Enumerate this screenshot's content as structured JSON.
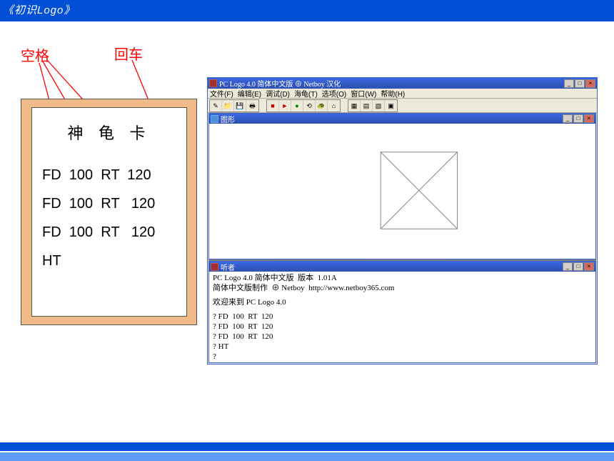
{
  "header": {
    "title": "《初识Logo》"
  },
  "labels": {
    "space": "空格",
    "enter": "回车"
  },
  "card": {
    "title": "神 龟 卡",
    "lines": [
      "FD  100  RT  120",
      "FD  100  RT   120",
      "FD  100  RT   120",
      "HT"
    ]
  },
  "app": {
    "title": "PC Logo 4.0 简体中文版 ⊕ Netboy  汉化",
    "menus": [
      "文件(F)",
      "编辑(E)",
      "调试(D)",
      "海龟(T)",
      "选项(O)",
      "窗口(W)",
      "帮助(H)"
    ],
    "window_controls": {
      "min": "_",
      "max": "□",
      "close": "×"
    },
    "sub_graphics": {
      "title": "图形"
    },
    "sub_listener": {
      "title": "听者",
      "version_line": "PC Logo 4.0 简体中文版  版本  1.01A",
      "credit_line": "简体中文版制作  ⊕ Netboy  http://www.netboy365.com",
      "welcome_line": "欢迎来到 PC Logo 4.0",
      "prompts": [
        "? FD  100  RT  120",
        "? FD  100  RT  120",
        "? FD  100  RT  120",
        "? HT",
        "?"
      ]
    }
  }
}
